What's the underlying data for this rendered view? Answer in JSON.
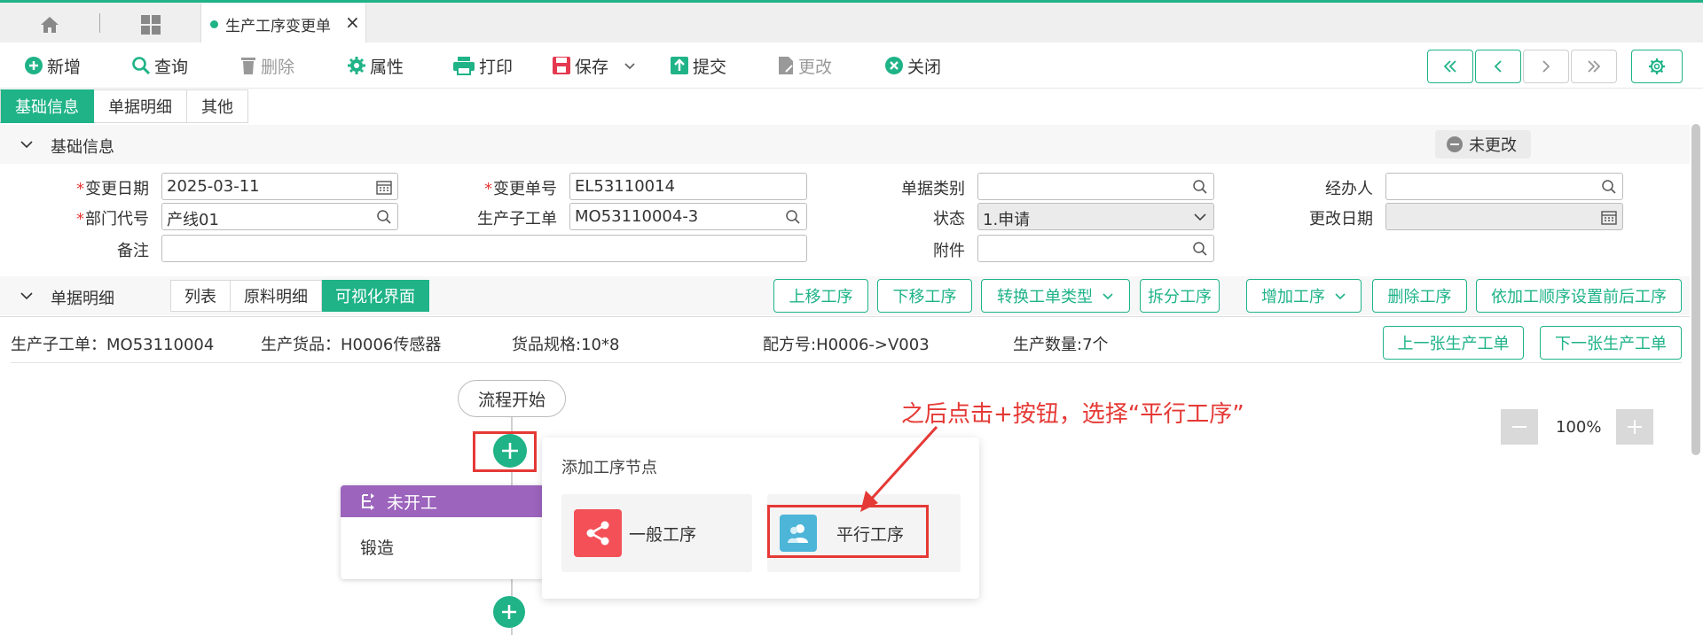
{
  "tabs": {
    "active_title": "生产工序变更单",
    "close": "×"
  },
  "toolbar": {
    "new": "新增",
    "query": "查询",
    "delete": "删除",
    "properties": "属性",
    "print": "打印",
    "save": "保存",
    "submit": "提交",
    "modify": "更改",
    "close": "关闭"
  },
  "main_tabs": [
    "基础信息",
    "单据明细",
    "其他"
  ],
  "basic_section": {
    "title": "基础信息",
    "status_badge": "未更改"
  },
  "form": {
    "change_date_label": "变更日期",
    "change_date": "2025-03-11",
    "change_no_label": "变更单号",
    "change_no": "EL53110014",
    "doc_type_label": "单据类别",
    "doc_type": "",
    "handler_label": "经办人",
    "handler": "",
    "dept_label": "部门代号",
    "dept": "产线01",
    "sub_order_label": "生产子工单",
    "sub_order": "MO53110004-3",
    "status_label": "状态",
    "status": "1.申请",
    "modify_date_label": "更改日期",
    "modify_date": "",
    "remark_label": "备注",
    "remark": "",
    "attach_label": "附件",
    "attach": ""
  },
  "detail_section": {
    "title": "单据明细",
    "views": [
      "列表",
      "原料明细",
      "可视化界面"
    ],
    "actions": [
      "上移工序",
      "下移工序",
      "转换工单类型",
      "拆分工序",
      "增加工序",
      "删除工序",
      "依加工顺序设置前后工序"
    ]
  },
  "info": {
    "sub_order": "生产子工单：MO53110004",
    "product": "生产货品：H0006传感器",
    "spec": "货品规格:10*8",
    "recipe": "配方号:H0006->V003",
    "qty": "生产数量:7个",
    "prev_order": "上一张生产工单",
    "next_order": "下一张生产工单"
  },
  "canvas": {
    "flow_start": "流程开始",
    "node_status": "未开工",
    "node_name": "锻造",
    "popup_title": "添加工序节点",
    "option_general": "一般工序",
    "option_parallel": "平行工序",
    "annotation": "之后点击+按钮，选择“平行工序”",
    "zoom": "100%"
  },
  "colors": {
    "accent": "#1fb387",
    "node_purple": "#9c64bd",
    "annotation_red": "#e53935"
  }
}
